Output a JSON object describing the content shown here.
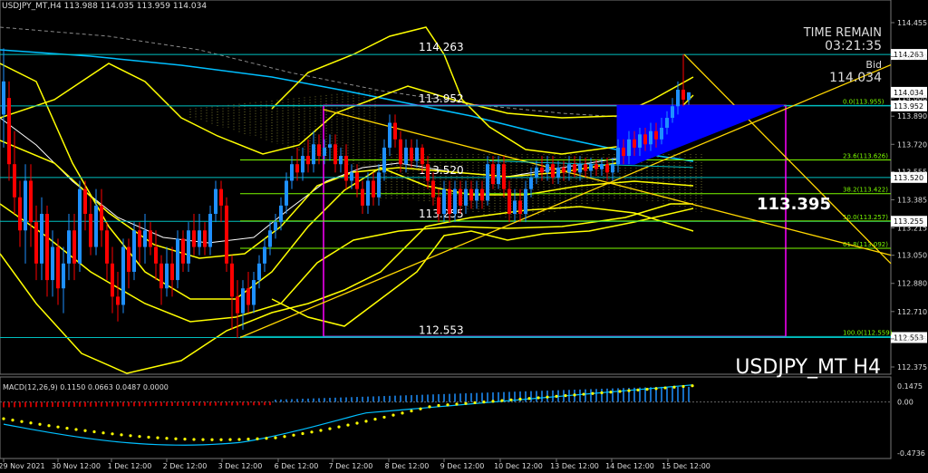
{
  "header": "USDJPY_MT,H4 113.988 114.035 113.959 114.034",
  "symbol_label": "USDJPY_MT H4",
  "time_remain": {
    "label": "TIME REMAIN",
    "value": "03:21:35"
  },
  "bid": {
    "label": "Bid",
    "value": "114.034"
  },
  "big_level_label": "113.395",
  "level_labels": [
    {
      "text": "114.263",
      "price": 114.263
    },
    {
      "text": "113.952",
      "price": 113.952
    },
    {
      "text": "113.520",
      "price": 113.52
    },
    {
      "text": "113.255",
      "price": 113.255
    },
    {
      "text": "112.553",
      "price": 112.553
    }
  ],
  "price_tags": [
    {
      "text": "114.263",
      "price": 114.263
    },
    {
      "text": "114.034",
      "price": 114.034
    },
    {
      "text": "113.952",
      "price": 113.952
    },
    {
      "text": "113.520",
      "price": 113.52
    },
    {
      "text": "113.255",
      "price": 113.255
    },
    {
      "text": "112.553",
      "price": 112.553
    }
  ],
  "fib_levels": [
    {
      "text": "0.0(113.955)",
      "price": 113.955
    },
    {
      "text": "23.6(113.626)",
      "price": 113.626
    },
    {
      "text": "38.2(113.422)",
      "price": 113.422
    },
    {
      "text": "50.0(113.257)",
      "price": 113.257
    },
    {
      "text": "61.8(113.092)",
      "price": 113.092
    },
    {
      "text": "100.0(112.559)",
      "price": 112.559
    }
  ],
  "macd": {
    "label": "MACD(12,26,9) 0.1150 0.0663 0.0487 0.0000",
    "ticks": [
      "0.1475",
      "0.00",
      "-0.4736"
    ]
  },
  "colors": {
    "background": "#000000",
    "bull": "#1e90ff",
    "bear": "#ff0000",
    "bands": "#ffff00",
    "fib_box": "#ff00ff",
    "levels": "#00bfbf",
    "fib_lines": "#7cfc00",
    "trend": "#ffd700"
  },
  "chart_data": {
    "type": "candlestick",
    "y_ticks": [
      "114.455",
      "114.250",
      "114.000",
      "113.890",
      "113.720",
      "113.555",
      "113.385",
      "113.215",
      "113.050",
      "112.880",
      "112.710",
      "112.545",
      "112.375"
    ],
    "x_ticks": [
      "29 Nov 2021",
      "30 Nov 12:00",
      "1 Dec 12:00",
      "2 Dec 12:00",
      "3 Dec 12:00",
      "6 Dec 12:00",
      "7 Dec 12:00",
      "8 Dec 12:00",
      "9 Dec 12:00",
      "10 Dec 12:00",
      "13 Dec 12:00",
      "14 Dec 12:00",
      "15 Dec 12:00"
    ],
    "last": {
      "open": 113.988,
      "high": 114.035,
      "low": 113.959,
      "close": 114.034
    }
  }
}
